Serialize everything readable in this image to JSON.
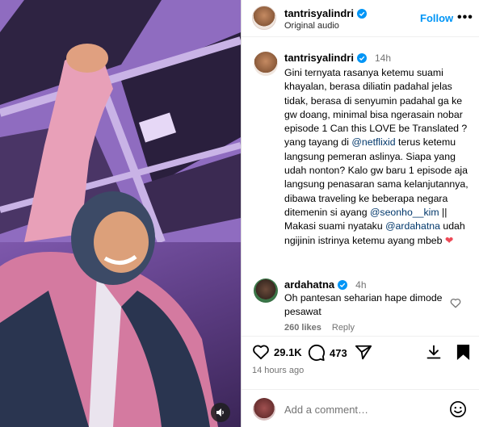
{
  "media": {
    "type": "video",
    "mute_icon": "speaker-icon"
  },
  "header": {
    "username": "tantrisyalindri",
    "subtitle": "Original audio",
    "follow_label": "Follow",
    "more_label": "•••"
  },
  "caption": {
    "username": "tantrisyalindri",
    "time": "14h",
    "parts": [
      {
        "text": "Gini ternyata rasanya ketemu suami khayalan, berasa diliatin padahal jelas tidak, berasa di senyumin padahal ga ke gw doang, minimal bisa ngerasain nobar episode 1 Can this LOVE be Translated ? yang tayang di ",
        "mention": false
      },
      {
        "text": "@netflixid",
        "mention": true
      },
      {
        "text": " terus ketemu langsung pemeran aslinya. Siapa yang udah nonton? Kalo gw baru 1 episode aja langsung penasaran sama kelanjutannya, dibawa traveling ke beberapa negara ditemenin si ayang ",
        "mention": false
      },
      {
        "text": "@seonho__kim",
        "mention": true
      },
      {
        "text": " || Makasi suami nyataku ",
        "mention": false
      },
      {
        "text": "@ardahatna",
        "mention": true
      },
      {
        "text": " udah ngijinin istrinya ketemu ayang mbeb ",
        "mention": false
      }
    ],
    "heart": "❤"
  },
  "comment": {
    "username": "ardahatna",
    "time": "4h",
    "text": "Oh pantesan seharian hape dimode pesawat",
    "likes": "260 likes",
    "reply_label": "Reply"
  },
  "actions": {
    "like_count": "29.1K",
    "comment_count": "473"
  },
  "posted": "14 hours ago",
  "comment_input": {
    "placeholder": "Add a comment…"
  },
  "colors": {
    "link": "#0095f6",
    "mention": "#00376b",
    "verified": "#0095f6",
    "heart": "#ed4956"
  }
}
